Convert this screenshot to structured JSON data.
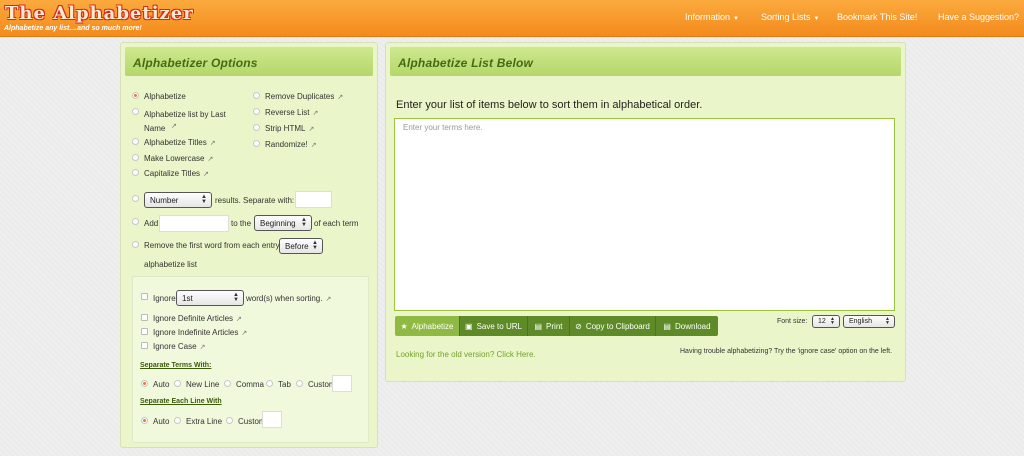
{
  "header": {
    "logo": "The Alphabetizer",
    "tagline": "Alphabetize any list....and so much more!",
    "nav": [
      {
        "label": "Information",
        "dropdown": true
      },
      {
        "label": "Sorting Lists",
        "dropdown": true
      },
      {
        "label": "Bookmark This Site!",
        "dropdown": false
      },
      {
        "label": "Have a Suggestion?",
        "dropdown": false
      }
    ]
  },
  "options": {
    "title": "Alphabetizer Options",
    "left_options": [
      "Alphabetize",
      "Alphabetize list by Last Name",
      "Alphabetize Titles",
      "Make Lowercase",
      "Capitalize Titles"
    ],
    "right_options": [
      "Remove Duplicates",
      "Reverse List",
      "Strip HTML",
      "Randomize!"
    ],
    "number_select": "Number",
    "results_label": "results. Separate with:",
    "add_label": "Add",
    "to_the_label": "to the",
    "position_select": "Beginning",
    "each_term_label": "of each term",
    "remove_first_label": "Remove the first word from each entry",
    "before_select": "Before",
    "alphabetize_list_label": "alphabetize list",
    "ignore_label": "Ignore",
    "ignore_count_select": "1st",
    "ignore_words_label": "word(s) when sorting.",
    "ignore_definite": "Ignore Definite Articles",
    "ignore_indefinite": "Ignore Indefinite Articles",
    "ignore_case": "Ignore Case",
    "sep_terms_title": "Separate Terms With:",
    "sep_terms": [
      "Auto",
      "New Line",
      "Comma",
      "Tab",
      "Custom"
    ],
    "sep_lines_title": "Separate Each Line With",
    "sep_lines": [
      "Auto",
      "Extra Line",
      "Custom"
    ]
  },
  "main": {
    "title": "Alphabetize List Below",
    "intro": "Enter your list of items below to sort them in alphabetical order.",
    "placeholder": "Enter your terms here.",
    "buttons": [
      "Alphabetize",
      "Save to URL",
      "Print",
      "Copy to Clipboard",
      "Download"
    ],
    "font_size_label": "Font size:",
    "font_size_value": "12",
    "language_value": "English",
    "old_version_link": "Looking for the old version? Click Here.",
    "trouble_text": "Having trouble alphabetizing? Try the 'ignore case' option on the left."
  },
  "colors": {
    "header_orange": "#f48a1c",
    "panel_green": "#eaf6c9",
    "title_green": "#466a14",
    "button_green": "#5e8b27",
    "radio_accent": "#ee7a22"
  }
}
